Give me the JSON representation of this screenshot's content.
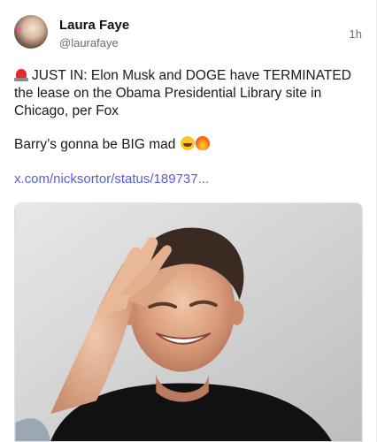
{
  "post": {
    "author_name": "Laura Faye",
    "author_handle": "@laurafaye",
    "time": "1h",
    "line1": "JUST IN: Elon Musk and DOGE have TERMINATED",
    "line2": "the lease on the Obama Presidential Library site in",
    "line3": "Chicago, per Fox",
    "line4": "Barry’s gonna be BIG mad",
    "link": "x.com/nicksortor/status/189737..."
  },
  "icons": {
    "avatar": "profile-photo",
    "siren": "police-light-emoji",
    "laugh": "rolling-on-floor-laughing-emoji",
    "fire": "fire-emoji"
  },
  "colors": {
    "link": "#5a5be0",
    "muted_text": "#6b6b6b",
    "body_text": "#1a1a1a"
  }
}
